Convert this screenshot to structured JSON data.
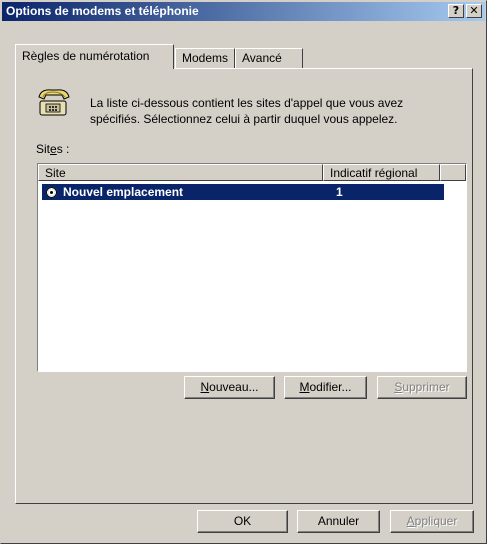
{
  "window": {
    "title": "Options de modems et téléphonie",
    "help_glyph": "?",
    "close_glyph": "✕"
  },
  "tabs": [
    {
      "label": "Règles de numérotation",
      "active": true
    },
    {
      "label": "Modems",
      "active": false
    },
    {
      "label": "Avancé",
      "active": false
    }
  ],
  "intro": {
    "icon": "phone-icon",
    "text": "La liste ci-dessous contient les sites d'appel que vous avez spécifiés. Sélectionnez celui à partir duquel vous appelez."
  },
  "sites": {
    "label_before": "Sit",
    "label_underlined": "e",
    "label_after": "s :",
    "columns": [
      "Site",
      "Indicatif régional"
    ],
    "rows": [
      {
        "name": "Nouvel emplacement",
        "area_code": "1",
        "selected": true,
        "icon": "selected-location-icon"
      }
    ]
  },
  "buttons": {
    "new": {
      "accel": "N",
      "rest": "ouveau..."
    },
    "modify": {
      "accel": "M",
      "rest": "odifier..."
    },
    "delete": {
      "accel": "S",
      "rest": "upprimer",
      "disabled": true
    },
    "ok": "OK",
    "cancel": "Annuler",
    "apply": {
      "accel": "A",
      "rest": "ppliquer",
      "disabled": true
    }
  },
  "colors": {
    "title_gradient_start": "#0a246a",
    "title_gradient_end": "#a6caf0",
    "selection": "#0a246a",
    "face": "#d4d0c8"
  }
}
